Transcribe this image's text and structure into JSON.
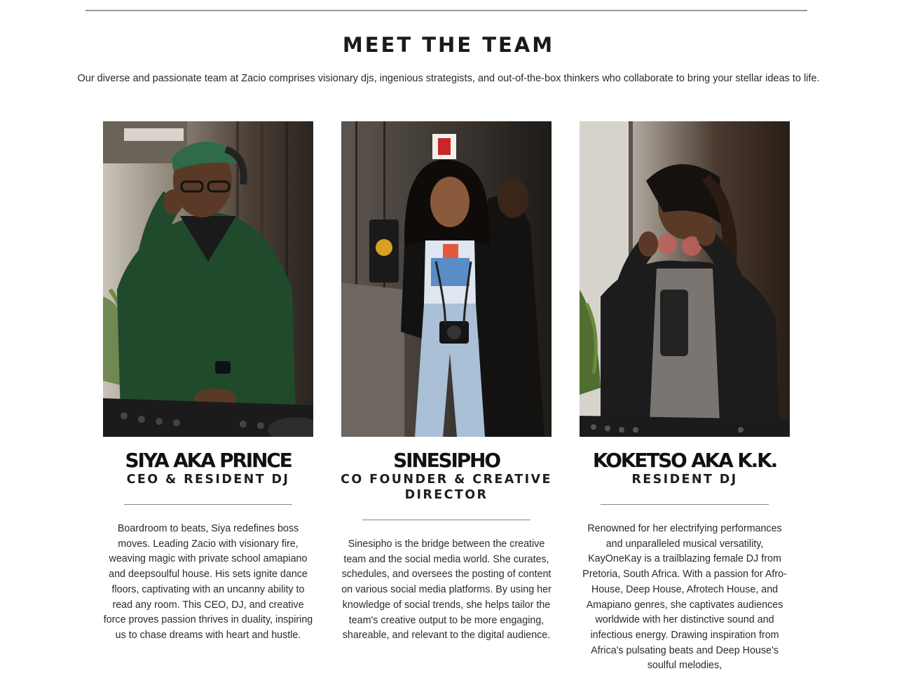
{
  "section": {
    "title": "MEET THE TEAM",
    "intro": "Our diverse and passionate team at Zacio comprises visionary djs, ingenious strategists, and out-of-the-box thinkers who collaborate to bring your stellar ideas to life."
  },
  "team": [
    {
      "name": "SIYA AKA PRINCE",
      "role": "CEO & RESIDENT DJ",
      "bio": "Boardroom to beats, Siya redefines boss moves. Leading Zacio with visionary fire, weaving magic with private school amapiano and deepsoulful house. His sets ignite dance floors, captivating with an uncanny ability to read any room. This CEO, DJ, and creative force proves passion thrives in duality, inspiring us to chase dreams with heart and hustle."
    },
    {
      "name": "SINESIPHO",
      "role": "CO FOUNDER & CREATIVE DIRECTOR",
      "bio": "Sinesipho is the bridge between the creative team and the social media world. She curates, schedules, and oversees the posting of content on various social media platforms. By using her knowledge of social trends, she helps tailor the team's creative output to be more engaging, shareable, and relevant to the digital audience."
    },
    {
      "name": "KOKETSO AKA K.K.",
      "role": "RESIDENT DJ",
      "bio": "Renowned for her electrifying performances and unparalleled musical versatility, KayOneKay is a trailblazing female DJ from Pretoria, South Africa. With a passion for Afro-House, Deep House, Afrotech House, and Amapiano genres, she captivates audiences worldwide with her distinctive sound and infectious energy. Drawing inspiration from Africa's pulsating beats and Deep House's soulful melodies,"
    }
  ]
}
